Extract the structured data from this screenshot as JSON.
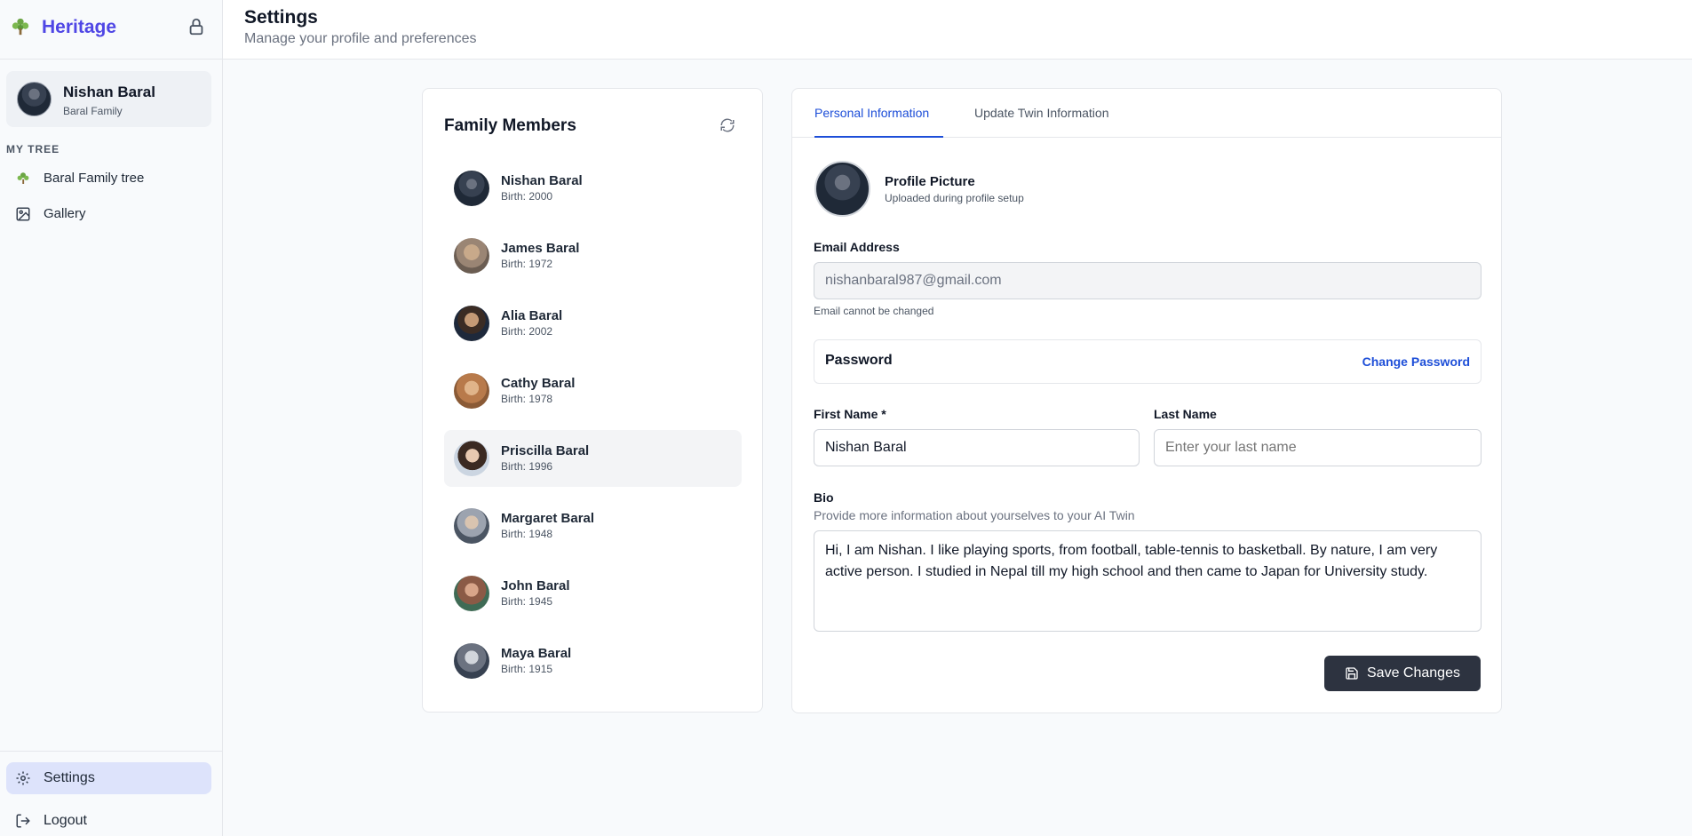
{
  "app": {
    "name": "Heritage"
  },
  "user": {
    "name": "Nishan Baral",
    "family": "Baral Family"
  },
  "sidebar": {
    "section_label": "MY TREE",
    "items": [
      {
        "label": "Baral Family tree",
        "icon": "tree-logo-icon"
      },
      {
        "label": "Gallery",
        "icon": "image-icon"
      }
    ],
    "bottom": [
      {
        "label": "Settings",
        "icon": "gear-icon",
        "active": true
      },
      {
        "label": "Logout",
        "icon": "logout-icon"
      }
    ]
  },
  "header": {
    "title": "Settings",
    "subtitle": "Manage your profile and preferences"
  },
  "family": {
    "title": "Family Members",
    "members": [
      {
        "name": "Nishan Baral",
        "birth": "Birth: 2000"
      },
      {
        "name": "James Baral",
        "birth": "Birth: 1972"
      },
      {
        "name": "Alia Baral",
        "birth": "Birth: 2002"
      },
      {
        "name": "Cathy Baral",
        "birth": "Birth: 1978"
      },
      {
        "name": "Priscilla Baral",
        "birth": "Birth: 1996"
      },
      {
        "name": "Margaret Baral",
        "birth": "Birth: 1948"
      },
      {
        "name": "John Baral",
        "birth": "Birth: 1945"
      },
      {
        "name": "Maya Baral",
        "birth": "Birth: 1915"
      }
    ]
  },
  "profile": {
    "tabs": [
      {
        "label": "Personal Information",
        "active": true
      },
      {
        "label": "Update Twin Information",
        "active": false
      }
    ],
    "picture_title": "Profile Picture",
    "picture_sub": "Uploaded during profile setup",
    "email_label": "Email Address",
    "email_value": "nishanbaral987@gmail.com",
    "email_hint": "Email cannot be changed",
    "password_label": "Password",
    "change_password": "Change Password",
    "first_name_label": "First Name *",
    "first_name_value": "Nishan Baral",
    "last_name_label": "Last Name",
    "last_name_placeholder": "Enter your last name",
    "bio_label": "Bio",
    "bio_sub": "Provide more information about yourselves to your AI Twin",
    "bio_value": "Hi, I am Nishan. I like playing sports, from football, table-tennis to basketball. By nature, I am very active person. I studied in Nepal till my high school and then came to Japan for University study.",
    "save_label": "Save Changes"
  },
  "colors": {
    "brand": "#4f46e5",
    "link": "#1d4ed8",
    "button": "#2d3340",
    "active_nav": "#dde3fb"
  }
}
